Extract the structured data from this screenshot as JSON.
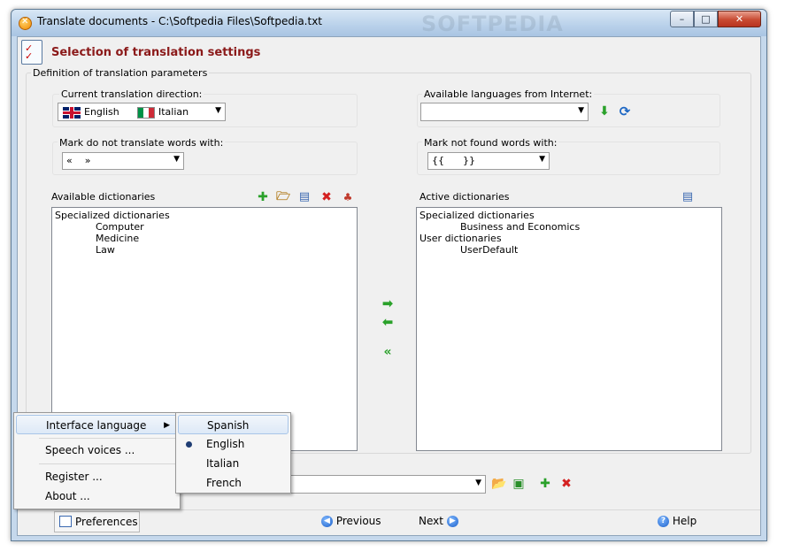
{
  "window": {
    "title": "Translate documents - C:\\Softpedia Files\\Softpedia.txt",
    "minimize_label": "–",
    "maximize_label": "□",
    "close_label": "✕"
  },
  "header": {
    "title": "Selection of translation settings"
  },
  "group": {
    "label": "Definition of translation parameters"
  },
  "direction": {
    "label": "Current translation direction:",
    "source_lang": "English",
    "target_lang": "Italian"
  },
  "internet_languages": {
    "label": "Available languages from Internet:",
    "value": ""
  },
  "mark_not_translate": {
    "label": "Mark do not translate words with:",
    "value": "«    »"
  },
  "mark_not_found": {
    "label": "Mark not found words with:",
    "value": "{{      }}"
  },
  "available_dicts": {
    "label": "Available dictionaries",
    "items": [
      {
        "text": "Specialized dictionaries",
        "level": 0
      },
      {
        "text": "Computer",
        "level": 1
      },
      {
        "text": "Medicine",
        "level": 1
      },
      {
        "text": "Law",
        "level": 1
      }
    ]
  },
  "active_dicts": {
    "label": "Active dictionaries",
    "items": [
      {
        "text": "Specialized dictionaries",
        "level": 0
      },
      {
        "text": "Business and Economics",
        "level": 1
      },
      {
        "text": "User dictionaries",
        "level": 0
      },
      {
        "text": "UserDefault",
        "level": 1
      }
    ]
  },
  "context_menu": {
    "items": [
      "Interface language",
      "Speech voices ...",
      "Register ...",
      "About ..."
    ]
  },
  "language_submenu": {
    "items": [
      "Spanish",
      "English",
      "Italian",
      "French"
    ],
    "highlighted": "Spanish",
    "selected": "English"
  },
  "bottom": {
    "preferences_label": "Preferences",
    "previous_label": "Previous",
    "next_label": "Next",
    "help_label": "Help"
  },
  "icons": {
    "accent": "#8b1a1a",
    "green": "#2aa12a",
    "red": "#d42020",
    "blue": "#1d67c4"
  }
}
